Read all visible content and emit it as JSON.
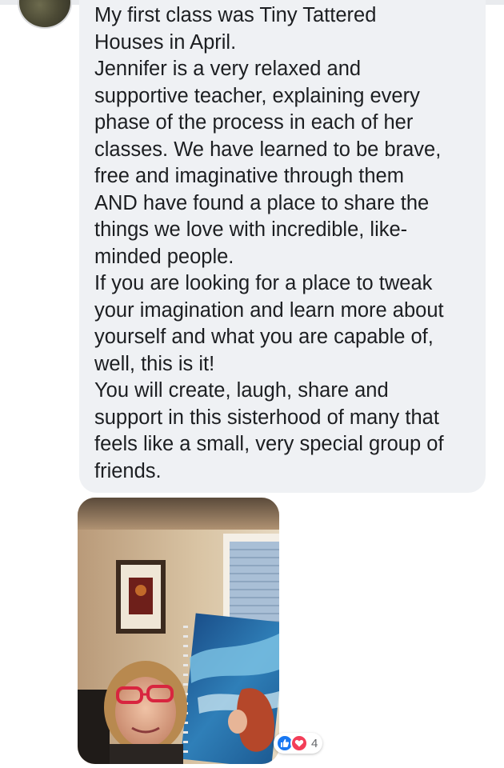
{
  "comment": {
    "lines": [
      "My first class was Tiny Tattered",
      "Houses in April.",
      "Jennifer is a very relaxed and",
      "supportive teacher, explaining every",
      "phase of the process in each of her",
      "classes.  We have learned to be brave,",
      "free and imaginative through them",
      "AND have found a place to share the",
      "things we love with incredible, like-",
      "minded people.",
      "If you are looking for a place to tweak",
      "your imagination and learn more about",
      "yourself and what you are capable of,",
      "well, this is it!",
      "You will create, laugh, share and",
      "support in this sisterhood of many that",
      "feels like a small, very special group of",
      "friends."
    ]
  },
  "attachment": {
    "icon": "photo-attachment"
  },
  "reactions": {
    "icons": [
      "like-icon",
      "love-icon"
    ],
    "count": "4",
    "colors": {
      "like": "#1877f2",
      "love": "#f33e58"
    }
  },
  "colors": {
    "bubble": "#eff1f4",
    "text": "#1c1e21"
  }
}
